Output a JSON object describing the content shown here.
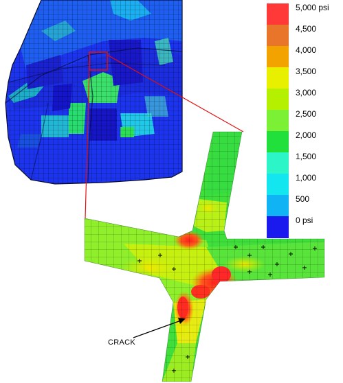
{
  "legend": {
    "items": [
      {
        "label": "5,000 psi",
        "color": "#ff3838"
      },
      {
        "label": "4,500",
        "color": "#e8752a"
      },
      {
        "label": "4,000",
        "color": "#f2a300"
      },
      {
        "label": "3,500",
        "color": "#e8f000"
      },
      {
        "label": "3,000",
        "color": "#b4f000"
      },
      {
        "label": "2,500",
        "color": "#7cf034"
      },
      {
        "label": "2,000",
        "color": "#22e03c"
      },
      {
        "label": "1,500",
        "color": "#2cf6c8"
      },
      {
        "label": "1,000",
        "color": "#14e6f0"
      },
      {
        "label": "500",
        "color": "#10b4f4"
      },
      {
        "label": "0 psi",
        "color": "#1a1aee"
      }
    ]
  },
  "annotation": {
    "crack_label": "CRACK"
  }
}
